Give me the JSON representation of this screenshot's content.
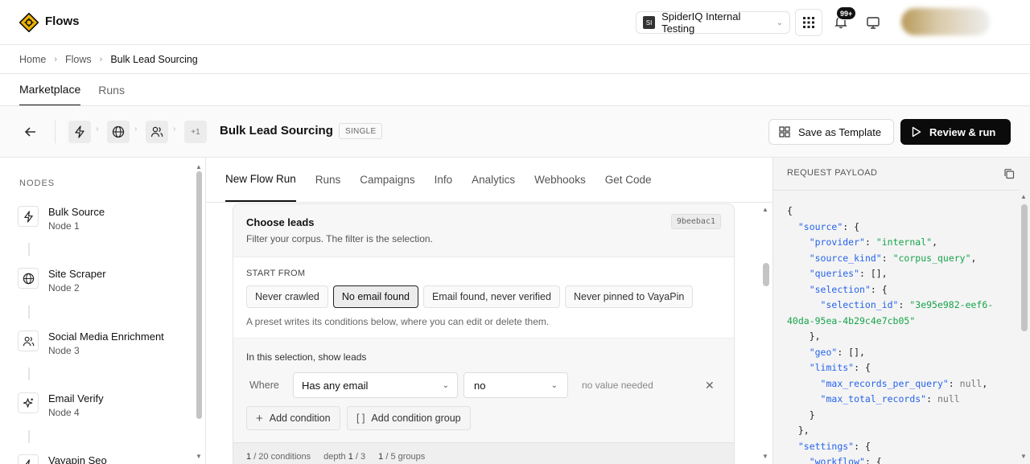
{
  "app": {
    "title": "Flows"
  },
  "topbar": {
    "workspace_badge": "SI",
    "workspace_name": "SpiderIQ Internal Testing",
    "notifications_count": "99+"
  },
  "breadcrumb": [
    "Home",
    "Flows",
    "Bulk Lead Sourcing"
  ],
  "main_tabs": [
    "Marketplace",
    "Runs"
  ],
  "flow": {
    "title": "Bulk Lead Sourcing",
    "mode_badge": "SINGLE",
    "more_nodes": "+1",
    "save_template_label": "Save as Template",
    "review_run_label": "Review & run"
  },
  "nodes": {
    "heading": "NODES",
    "items": [
      {
        "name": "Bulk Source",
        "sub": "Node 1",
        "icon": "bolt-icon"
      },
      {
        "name": "Site Scraper",
        "sub": "Node 2",
        "icon": "globe-icon"
      },
      {
        "name": "Social Media Enrichment",
        "sub": "Node 3",
        "icon": "users-icon"
      },
      {
        "name": "Email Verify",
        "sub": "Node 4",
        "icon": "sparkles-icon"
      },
      {
        "name": "Vayapin Seo",
        "sub": "",
        "icon": "bolt-icon"
      }
    ]
  },
  "center_tabs": [
    "New Flow Run",
    "Runs",
    "Campaigns",
    "Info",
    "Analytics",
    "Webhooks",
    "Get Code"
  ],
  "card": {
    "title": "Choose leads",
    "subtitle": "Filter your corpus. The filter is the selection.",
    "hash": "9beebac1",
    "start_from_label": "START FROM",
    "presets": [
      "Never crawled",
      "No email found",
      "Email found, never verified",
      "Never pinned to VayaPin"
    ],
    "active_preset": "No email found",
    "preset_hint": "A preset writes its conditions below, where you can edit or delete them.",
    "selection_label": "In this selection, show leads",
    "condition": {
      "where_label": "Where",
      "field": "Has any email",
      "operator": "no",
      "value_placeholder": "no value needed"
    },
    "add_condition_label": "Add condition",
    "add_group_label": "Add condition group",
    "footer": {
      "conditions_used": "1",
      "conditions_max": "/ 20 conditions",
      "depth_label": "depth",
      "depth_used": "1",
      "depth_max": "/ 3",
      "groups_used": "1",
      "groups_max": "/ 5 groups"
    }
  },
  "payload": {
    "title": "REQUEST PAYLOAD",
    "json_lines": [
      "{",
      "  \"source\": {",
      "    \"provider\": \"internal\",",
      "    \"source_kind\": \"corpus_query\",",
      "    \"queries\": [],",
      "    \"selection\": {",
      "      \"selection_id\": \"3e95e982-eef6-",
      "40da-95ea-4b29c4e7cb05\"",
      "    },",
      "    \"geo\": [],",
      "    \"limits\": {",
      "      \"max_records_per_query\": null,",
      "      \"max_total_records\": null",
      "    }",
      "  },",
      "  \"settings\": {",
      "    \"workflow\": {"
    ]
  },
  "colors": {
    "json_key": "#2563eb",
    "json_string": "#16a34a",
    "primary_button": "#0b0b0b",
    "logo": "#f0b400"
  }
}
